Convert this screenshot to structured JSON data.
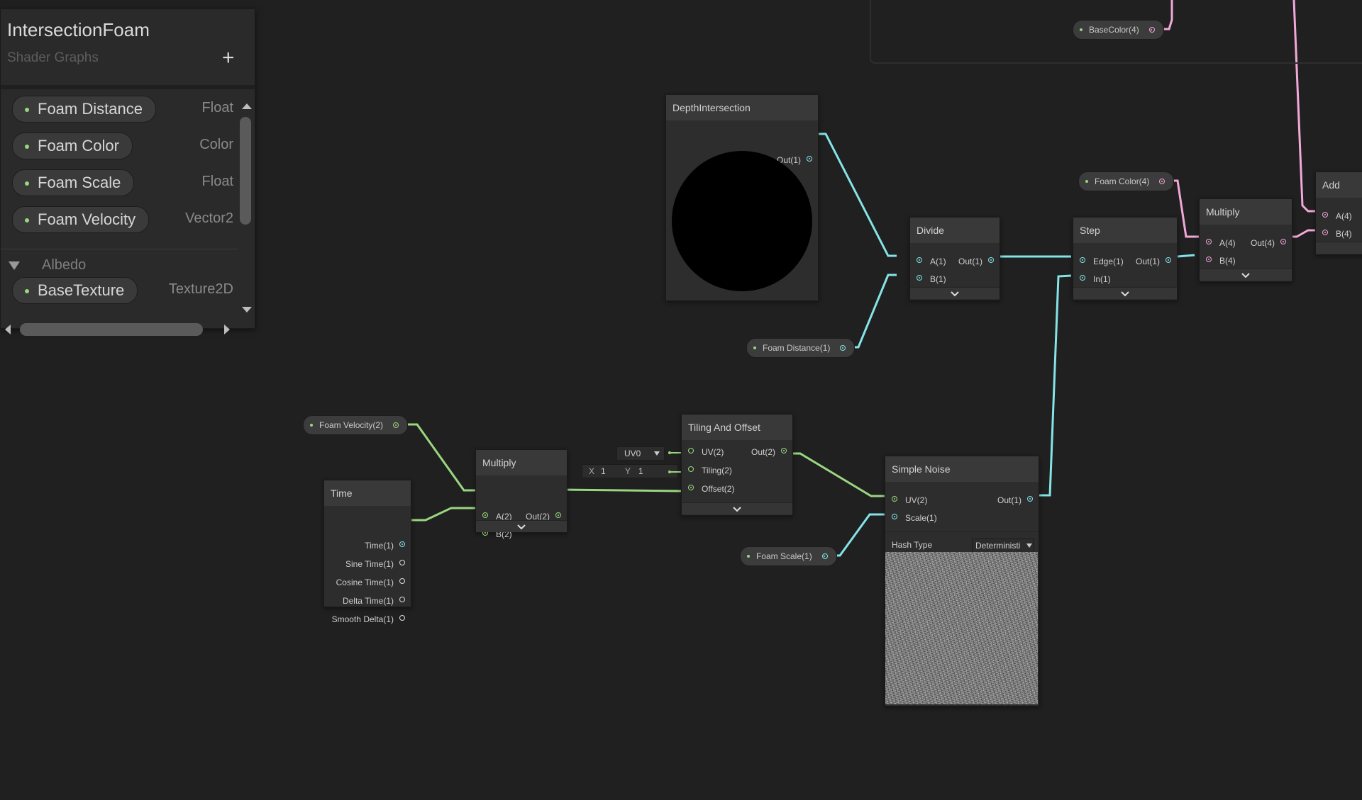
{
  "blackboard": {
    "title": "IntersectionFoam",
    "subtitle": "Shader Graphs",
    "add_label": "+",
    "properties": [
      {
        "name": "Foam Distance",
        "type": "Float"
      },
      {
        "name": "Foam Color",
        "type": "Color"
      },
      {
        "name": "Foam Scale",
        "type": "Float"
      },
      {
        "name": "Foam Velocity",
        "type": "Vector2"
      },
      {
        "name": "BaseTexture",
        "type": "Texture2D"
      }
    ],
    "category": "Albedo"
  },
  "nodes": {
    "depth": {
      "title": "DepthIntersection",
      "out": "Out(1)"
    },
    "divide": {
      "title": "Divide",
      "a": "A(1)",
      "b": "B(1)",
      "out": "Out(1)"
    },
    "step": {
      "title": "Step",
      "edge": "Edge(1)",
      "in": "In(1)",
      "out": "Out(1)"
    },
    "multiply_right": {
      "title": "Multiply",
      "a": "A(4)",
      "b": "B(4)",
      "out": "Out(4)"
    },
    "add": {
      "title": "Add",
      "a": "A(4)",
      "b": "B(4)"
    },
    "time": {
      "title": "Time",
      "outputs": [
        "Time(1)",
        "Sine Time(1)",
        "Cosine Time(1)",
        "Delta Time(1)",
        "Smooth Delta(1)"
      ]
    },
    "multiply_left": {
      "title": "Multiply",
      "a": "A(2)",
      "b": "B(2)",
      "out": "Out(2)"
    },
    "tiling": {
      "title": "Tiling And Offset",
      "uv": "UV(2)",
      "tiling": "Tiling(2)",
      "offset": "Offset(2)",
      "out": "Out(2)",
      "uv_channel": "UV0",
      "x_label": "X",
      "x_value": "1",
      "y_label": "Y",
      "y_value": "1"
    },
    "noise": {
      "title": "Simple Noise",
      "uv": "UV(2)",
      "scale": "Scale(1)",
      "out": "Out(1)",
      "hash_label": "Hash Type",
      "hash_value": "Deterministi"
    }
  },
  "pills": {
    "base_color": "BaseColor(4)",
    "foam_color": "Foam Color(4)",
    "foam_distance": "Foam Distance(1)",
    "foam_velocity": "Foam Velocity(2)",
    "foam_scale": "Foam Scale(1)"
  },
  "colors": {
    "float_wire": "#84e4e7",
    "vector2_wire": "#9ad680",
    "vector4_wire": "#f2a8d8",
    "background": "#202020"
  }
}
